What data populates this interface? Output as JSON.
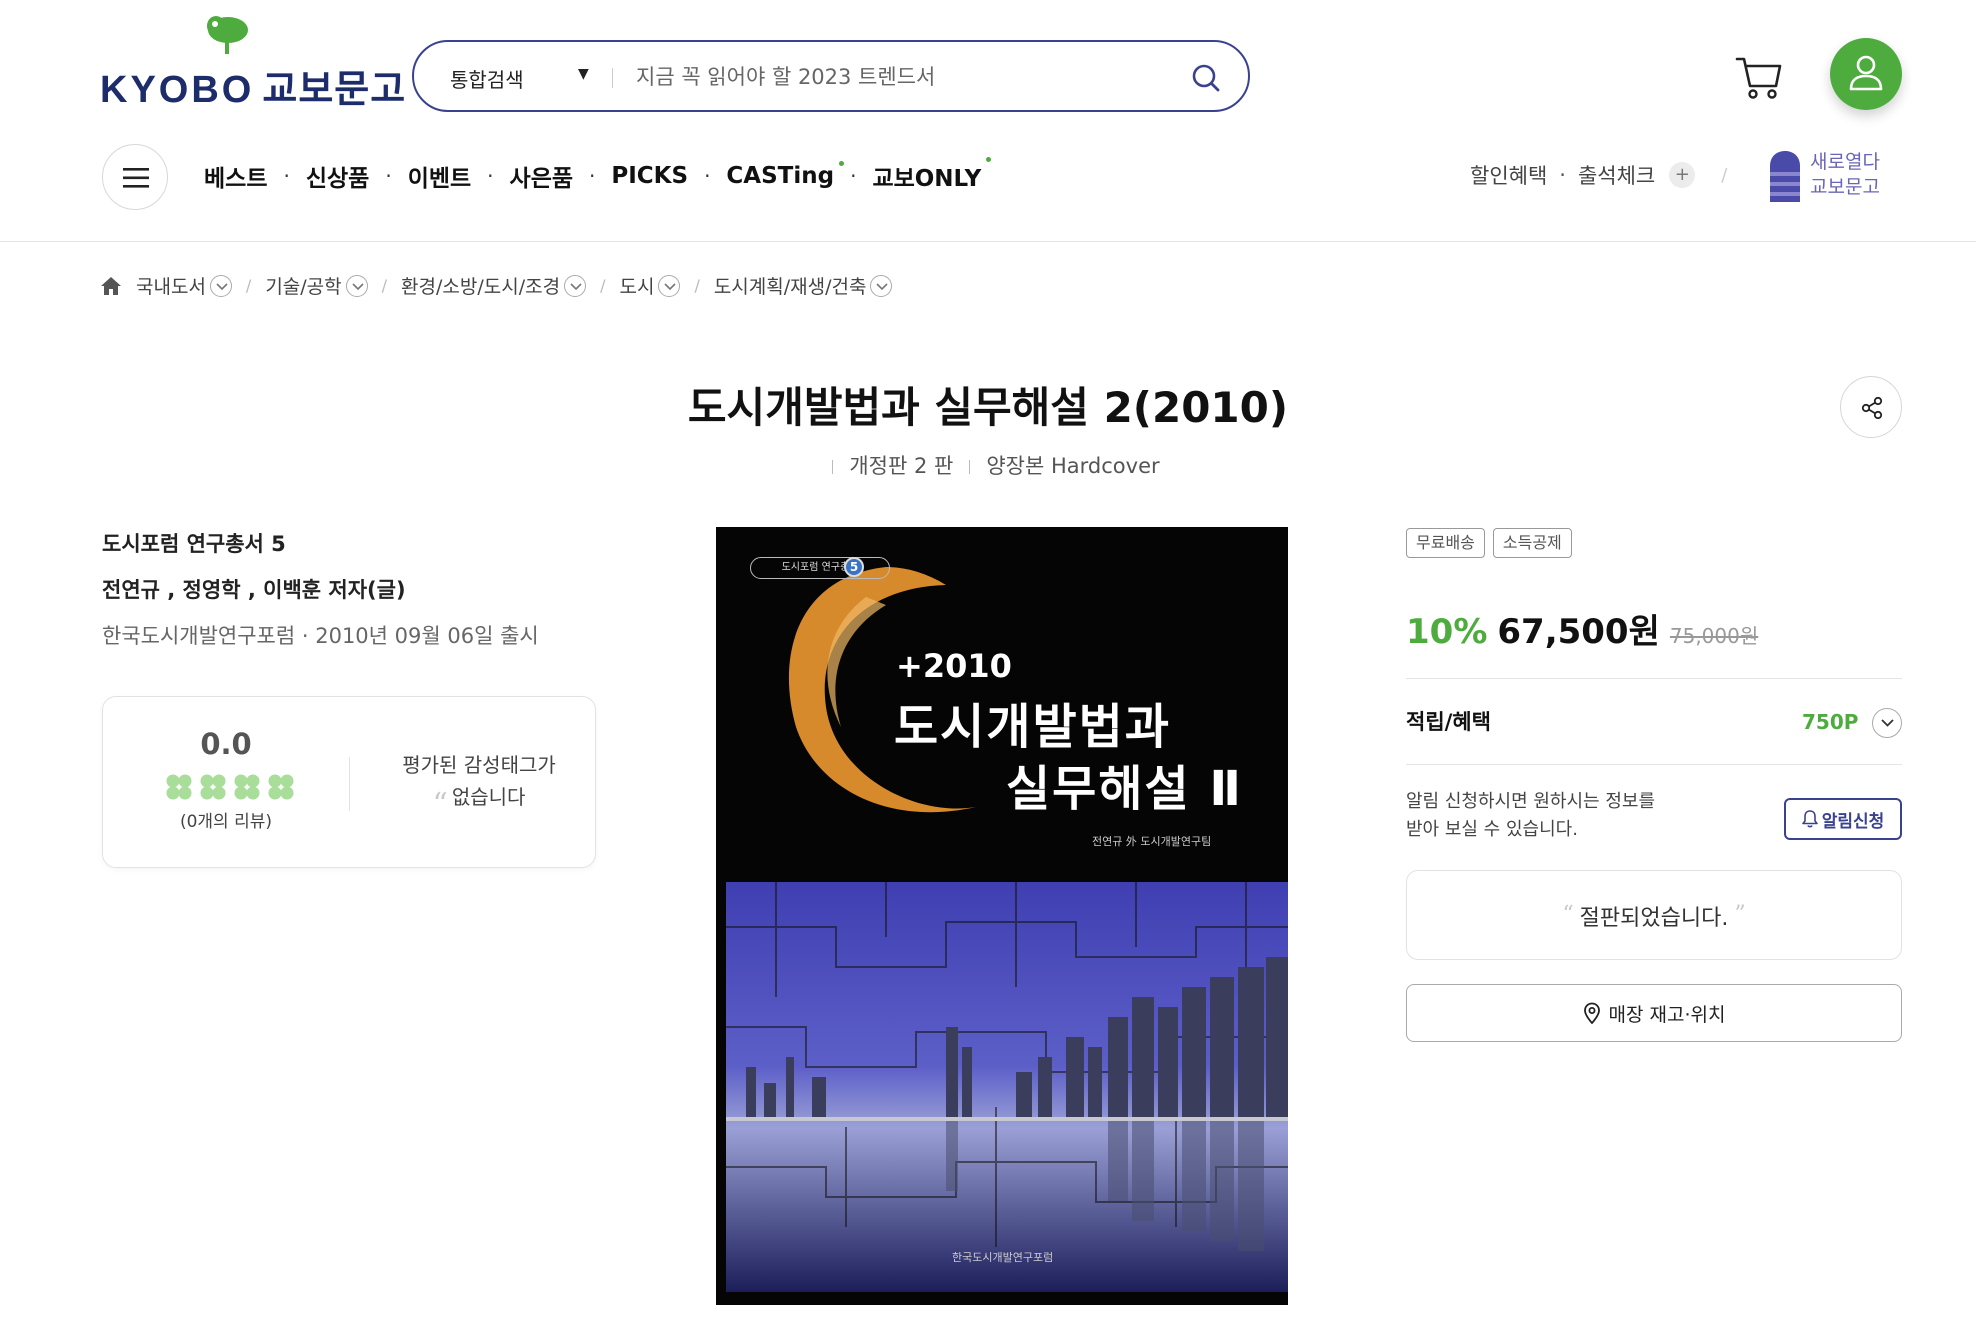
{
  "header": {
    "logo_text": "KYOBO",
    "logo_ko": "교보문고",
    "search": {
      "category": "통합검색",
      "placeholder": "지금 꼭 읽어야 할 2023 트렌드서"
    },
    "nav": [
      {
        "label": "베스트",
        "new": false
      },
      {
        "label": "신상품",
        "new": false
      },
      {
        "label": "이벤트",
        "new": false
      },
      {
        "label": "사은품",
        "new": false
      },
      {
        "label": "PICKS",
        "new": false
      },
      {
        "label": "CASTing",
        "new": true
      },
      {
        "label": "교보ONLY",
        "new": true
      }
    ],
    "util": {
      "discount": "할인혜택",
      "attendance": "출석체크",
      "plus": "+",
      "banner_line1": "새로열다",
      "banner_line2": "교보문고"
    }
  },
  "breadcrumb": [
    "국내도서",
    "기술/공학",
    "환경/소방/도시/조경",
    "도시",
    "도시계획/재생/건축"
  ],
  "product": {
    "title": "도시개발법과 실무해설 2(2010)",
    "edition": "개정판 2 판",
    "binding": "양장본 Hardcover",
    "series": "도시포럼 연구총서 5",
    "authors": "전연규 , 정영학 , 이백훈 저자(글)",
    "publisher_date": "한국도시개발연구포럼 · 2010년 09월 06일 출시"
  },
  "review": {
    "score": "0.0",
    "clover_count": 4,
    "count_text": "(0개의 리뷰)",
    "emotion_line1": "평가된 감성태그가",
    "emotion_line2": "없습니다"
  },
  "cover": {
    "series_tag": "도시포럼 연구총서",
    "series_num": "5",
    "year": "+2010",
    "title_line1": "도시개발법과",
    "title_line2": "실무해설 Ⅱ",
    "author": "전연규 外 도시개발연구팀",
    "publisher": "한국도시개발연구포럼"
  },
  "purchase": {
    "badges": [
      "무료배송",
      "소득공제"
    ],
    "discount": "10%",
    "price": "67,500원",
    "original_price": "75,000원",
    "points_label": "적립/혜택",
    "points_value": "750P",
    "notify_line1": "알림 신청하시면 원하시는 정보를",
    "notify_line2": "받아 보실 수 있습니다.",
    "notify_button": "알림신청",
    "soldout": "절판되었습니다.",
    "store_button": "매장 재고·위치"
  },
  "colors": {
    "brand_navy": "#3a4290",
    "brand_green": "#4dac3d",
    "cover_swoosh": "#d68a2c"
  }
}
